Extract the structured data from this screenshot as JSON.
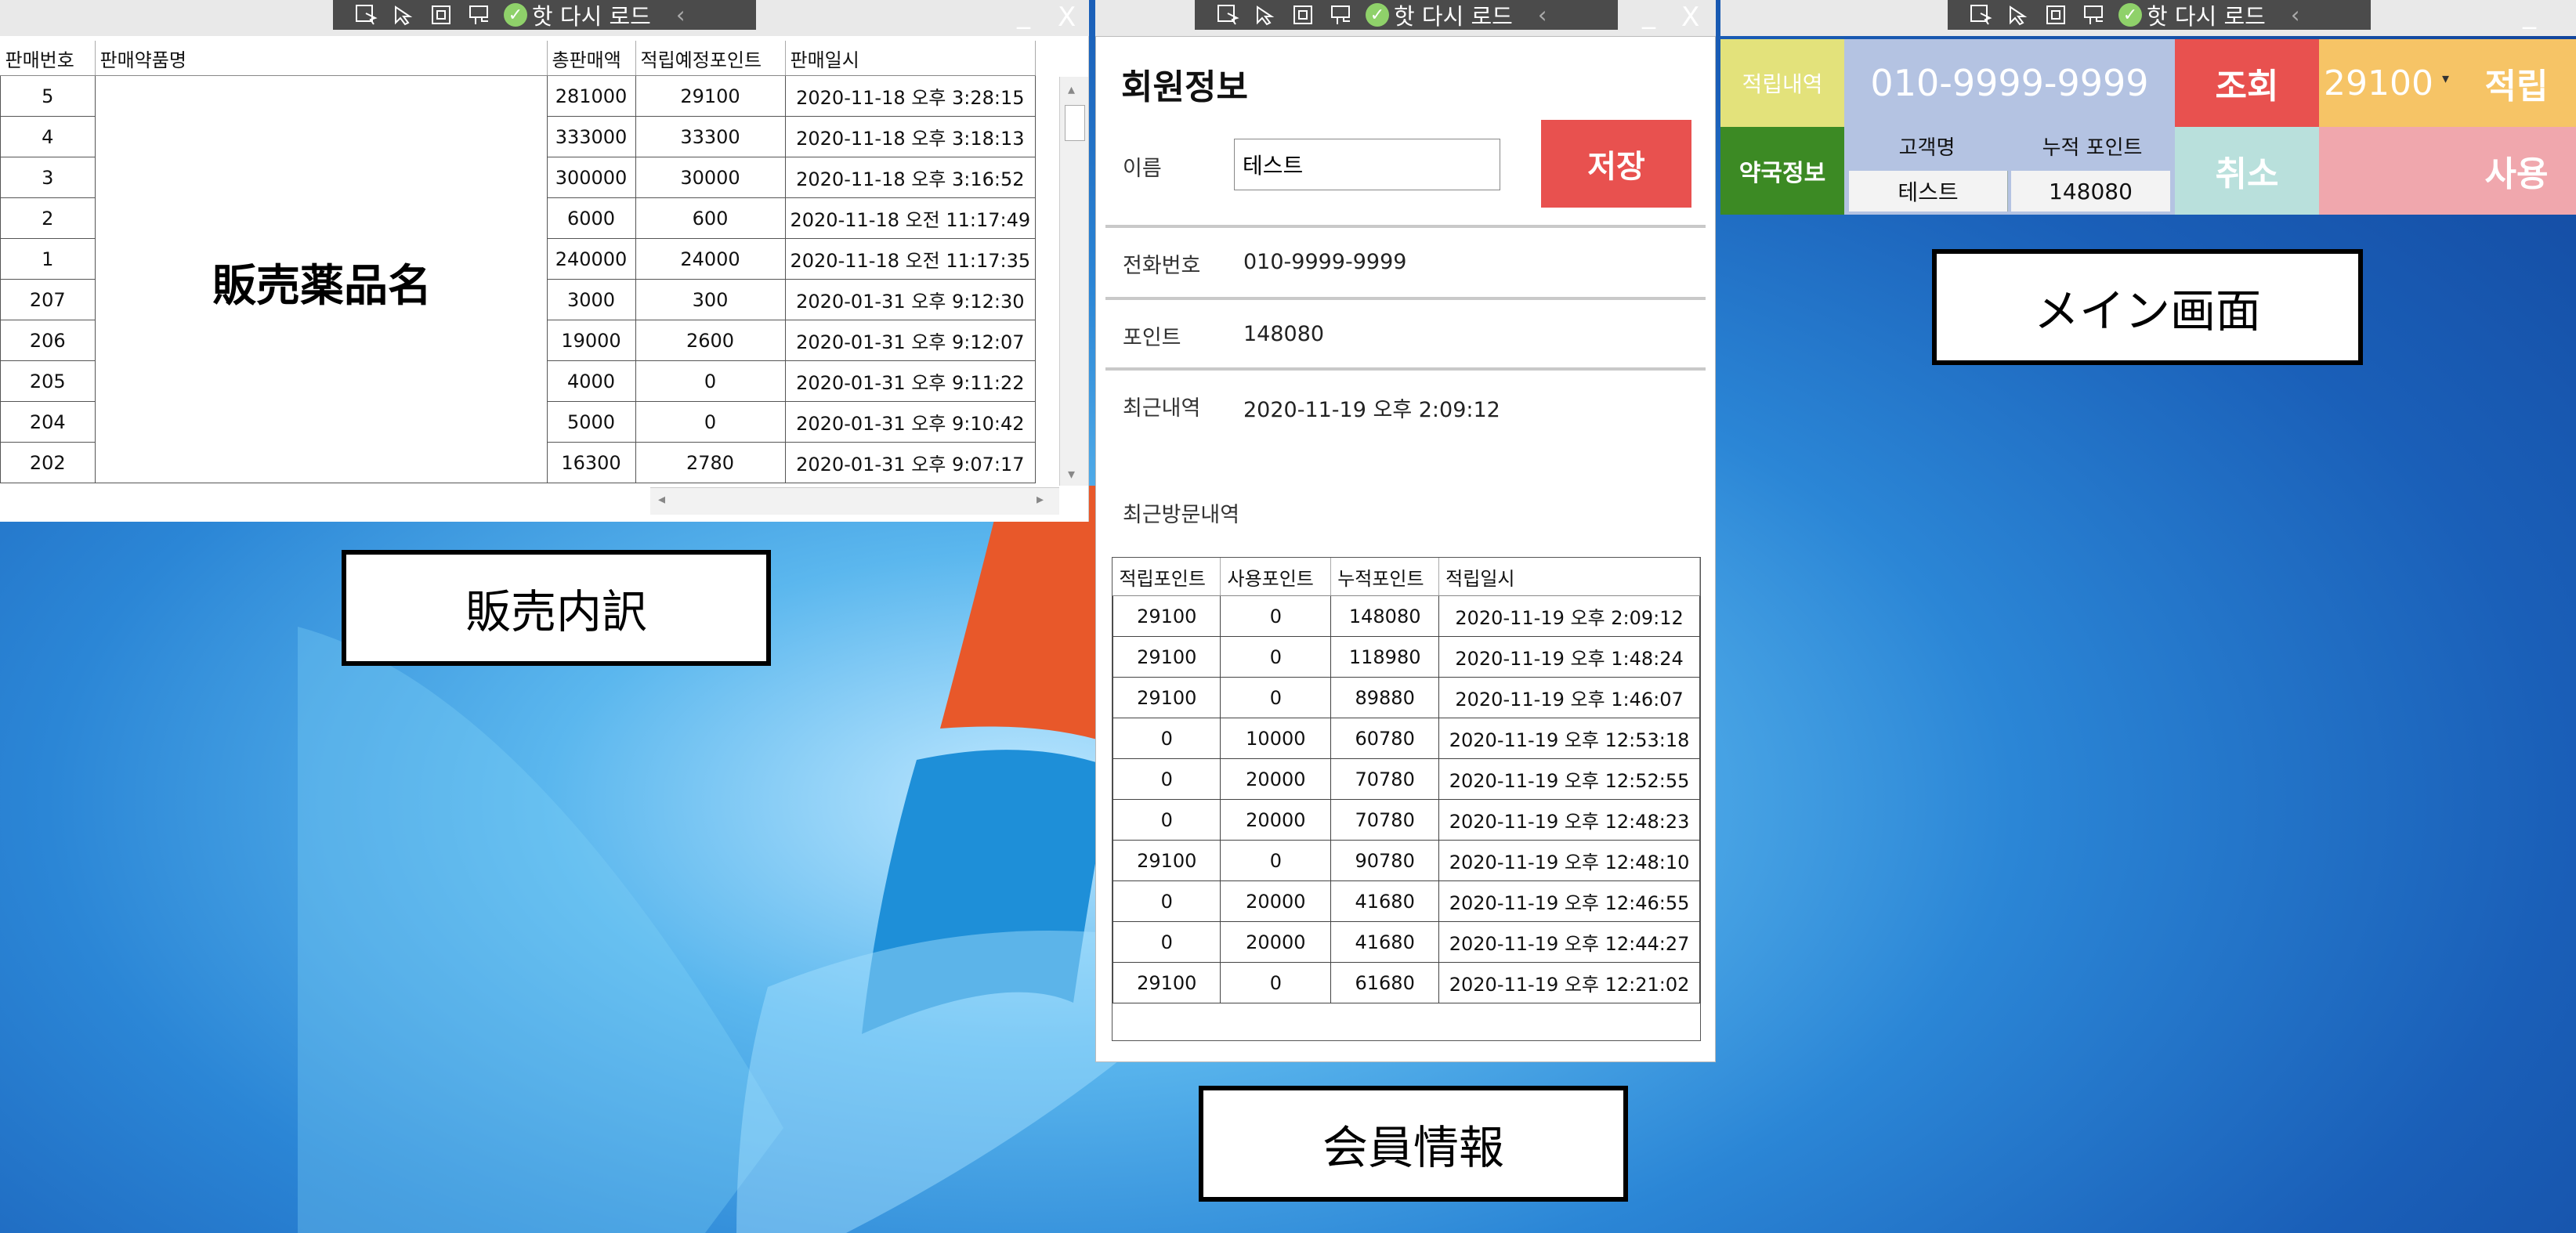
{
  "toolbar": {
    "reload_label": "핫 다시 로드",
    "minimize": "_",
    "close": "X",
    "icons": [
      "select-element-icon",
      "pointer-icon",
      "layout-icon",
      "live-tree-icon",
      "check-icon",
      "chevron-left-icon"
    ]
  },
  "sales_window": {
    "columns": [
      "판매번호",
      "판매약품명",
      "총판매액",
      "적립예정포인트",
      "판매일시"
    ],
    "merged_product_name": "販売薬品名",
    "rows": [
      {
        "no": "5",
        "total": "281000",
        "points": "29100",
        "date": "2020-11-18 오후 3:28:15"
      },
      {
        "no": "4",
        "total": "333000",
        "points": "33300",
        "date": "2020-11-18 오후 3:18:13"
      },
      {
        "no": "3",
        "total": "300000",
        "points": "30000",
        "date": "2020-11-18 오후 3:16:52"
      },
      {
        "no": "2",
        "total": "6000",
        "points": "600",
        "date": "2020-11-18 오전 11:17:49"
      },
      {
        "no": "1",
        "total": "240000",
        "points": "24000",
        "date": "2020-11-18 오전 11:17:35"
      },
      {
        "no": "207",
        "total": "3000",
        "points": "300",
        "date": "2020-01-31 오후 9:12:30"
      },
      {
        "no": "206",
        "total": "19000",
        "points": "2600",
        "date": "2020-01-31 오후 9:12:07"
      },
      {
        "no": "205",
        "total": "4000",
        "points": "0",
        "date": "2020-01-31 오후 9:11:22"
      },
      {
        "no": "204",
        "total": "5000",
        "points": "0",
        "date": "2020-01-31 오후 9:10:42"
      },
      {
        "no": "202",
        "total": "16300",
        "points": "2780",
        "date": "2020-01-31 오후 9:07:17"
      }
    ]
  },
  "captions": {
    "sales": "販売内訳",
    "member": "会員情報",
    "main": "メイン画面"
  },
  "member_window": {
    "title": "회원정보",
    "name_label": "이름",
    "name_value": "테스트",
    "save_label": "저장",
    "phone_label": "전화번호",
    "phone_value": "010-9999-9999",
    "point_label": "포인트",
    "point_value": "148080",
    "recent_label": "최근내역",
    "recent_value": "2020-11-19 오후 2:09:12",
    "visits_label": "최근방문내역",
    "visit_columns": [
      "적립포인트",
      "사용포인트",
      "누적포인트",
      "적립일시"
    ],
    "visits": [
      [
        "29100",
        "0",
        "148080",
        "2020-11-19 오후 2:09:12"
      ],
      [
        "29100",
        "0",
        "118980",
        "2020-11-19 오후 1:48:24"
      ],
      [
        "29100",
        "0",
        "89880",
        "2020-11-19 오후 1:46:07"
      ],
      [
        "0",
        "10000",
        "60780",
        "2020-11-19 오후 12:53:18"
      ],
      [
        "0",
        "20000",
        "70780",
        "2020-11-19 오후 12:52:55"
      ],
      [
        "0",
        "20000",
        "70780",
        "2020-11-19 오후 12:48:23"
      ],
      [
        "29100",
        "0",
        "90780",
        "2020-11-19 오후 12:48:10"
      ],
      [
        "0",
        "20000",
        "41680",
        "2020-11-19 오후 12:46:55"
      ],
      [
        "0",
        "20000",
        "41680",
        "2020-11-19 오후 12:44:27"
      ],
      [
        "29100",
        "0",
        "61680",
        "2020-11-19 오후 12:21:02"
      ]
    ]
  },
  "main_panel": {
    "history_label": "적립내역",
    "pharmacy_label": "약국정보",
    "phone": "010-9999-9999",
    "customer_header": "고객명",
    "points_header": "누적 포인트",
    "customer_name": "테스트",
    "customer_points": "148080",
    "lookup_label": "조회",
    "cancel_label": "취소",
    "amount_value": "29100",
    "earn_label": "적립",
    "use_label": "사용",
    "colors": {
      "history_bg": "#e3e27b",
      "pharmacy_bg": "#3c8a24",
      "phone_bg": "#b4c3e2",
      "lookup_bg": "#e8514f",
      "cancel_bg": "#b9e0dc",
      "amount_bg": "#f6c466",
      "pink_bg": "#f0a7ad",
      "earn_bg": "#f6c466",
      "use_bg": "#f0a7ad"
    }
  }
}
